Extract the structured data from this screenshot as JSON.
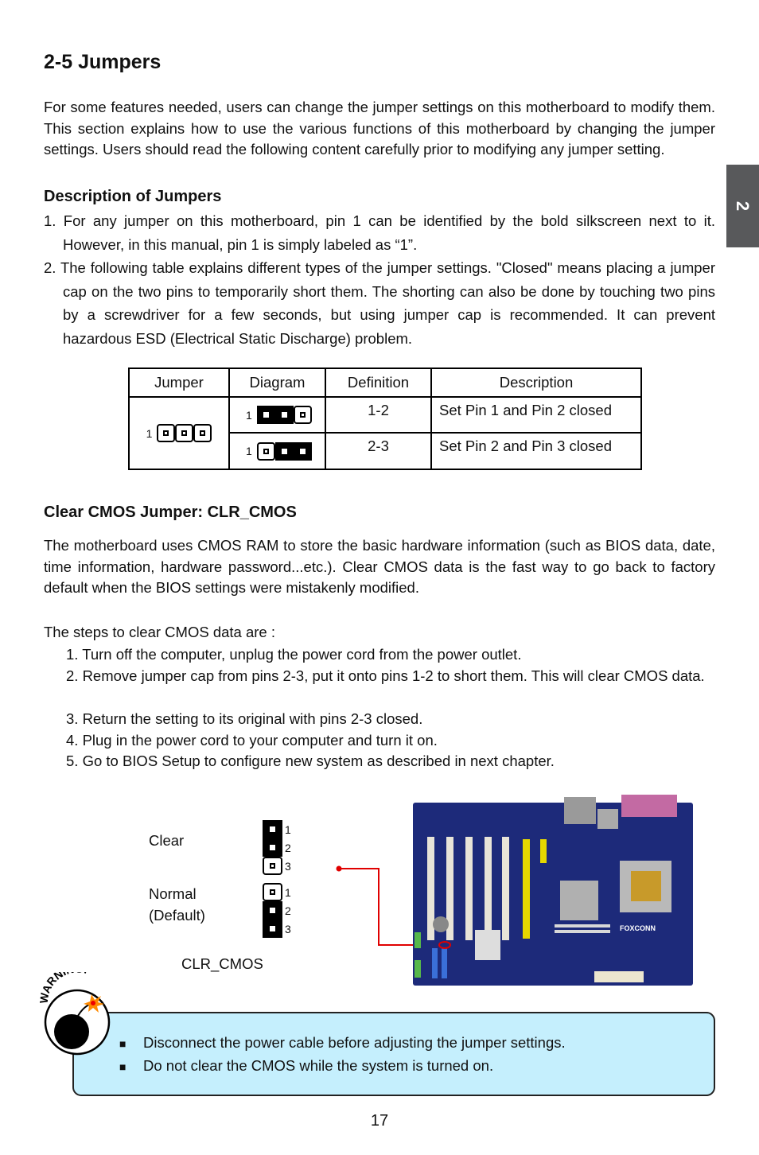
{
  "title": "2-5 Jumpers",
  "chapter_tab": "2",
  "intro": "For some features needed, users can change the jumper settings on this motherboard to modify them. This section explains how to use the various functions of this motherboard by changing the jumper settings. Users should read the following content carefully prior to modifying any jumper setting.",
  "description": {
    "heading": "Description of Jumpers",
    "items": [
      "1. For any jumper on this motherboard, pin 1 can be identified by the bold silkscreen next to it. However, in this manual, pin 1 is simply labeled as “1”.",
      "2. The following table explains different types of the jumper settings. \"Closed\" means placing a jumper cap on the two pins to temporarily short them. The shorting can also be done by touching two pins by a screwdriver for a few seconds, but using jumper cap is recommended. It can prevent hazardous ESD (Electrical Static Discharge) problem."
    ]
  },
  "table": {
    "headers": [
      "Jumper",
      "Diagram",
      "Definition",
      "Description"
    ],
    "pin_label": "1",
    "jumper_pins": [
      false,
      false,
      false
    ],
    "rows": [
      {
        "pins": [
          true,
          true,
          false
        ],
        "definition": "1-2",
        "description": "Set Pin 1 and Pin 2 closed"
      },
      {
        "pins": [
          false,
          true,
          true
        ],
        "definition": "2-3",
        "description": "Set Pin 2 and Pin 3 closed"
      }
    ]
  },
  "clr_cmos": {
    "heading": "Clear CMOS Jumper: CLR_CMOS",
    "paragraph": "The motherboard uses CMOS RAM to store the basic hardware information (such as BIOS data, date, time information, hardware password...etc.). Clear CMOS data is the fast way to go back to factory default when the BIOS settings were mistakenly modified.",
    "steps_intro": "The steps to clear CMOS data are :",
    "steps": [
      "1. Turn off the computer, unplug the power cord from the power outlet.",
      "2. Remove jumper cap from pins 2-3, put it onto pins 1-2 to short them. This will clear CMOS data.",
      "3. Return the setting to its original with pins 2-3 closed.",
      "4. Plug in the power cord to your computer and turn it on.",
      "5. Go to BIOS Setup to configure new system as described in next chapter."
    ],
    "diagram": {
      "clear_label": "Clear",
      "normal_label": "Normal",
      "default_label": "(Default)",
      "jumper_name": "CLR_CMOS",
      "pin_numbers": [
        "1",
        "2",
        "3"
      ],
      "clear_pins": [
        true,
        true,
        false
      ],
      "normal_pins": [
        false,
        true,
        true
      ]
    },
    "board_logo": "FOXCONN"
  },
  "warning": {
    "badge": "WARNING!",
    "items": [
      "Disconnect the power cable before adjusting the jumper settings.",
      "Do not clear the CMOS while the system is turned on."
    ]
  },
  "page_number": "17",
  "colors": {
    "warning_bg": "#c5effd",
    "tab_bg": "#58595b",
    "pointer": "#e00000",
    "board": "#1d2a7a"
  }
}
